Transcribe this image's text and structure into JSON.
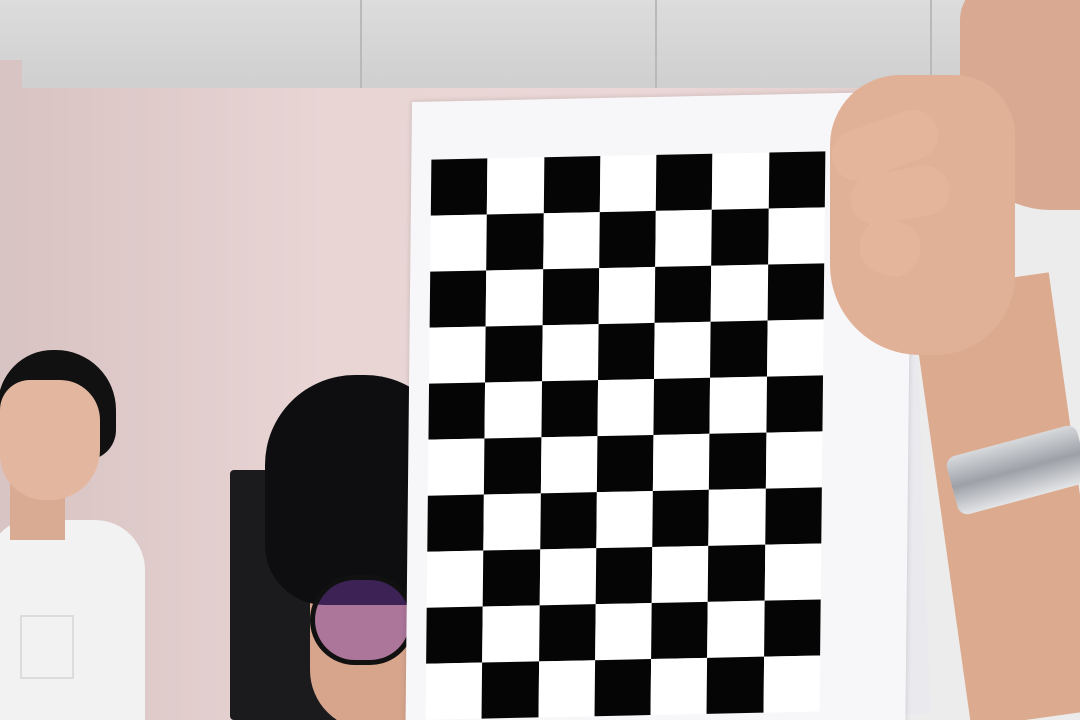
{
  "scene": {
    "description_tags": [
      "ceiling",
      "wall",
      "monitor",
      "person-left",
      "person-center",
      "person-right",
      "calibration-checkerboard"
    ]
  },
  "checkerboard": {
    "columns": 7,
    "rows": 10,
    "dark_color": "#050505",
    "light_color": "#ffffff",
    "first_square_dark": false
  },
  "colors": {
    "wall": "#e8d5d4",
    "ceiling": "#d6d6d6",
    "skin": "#e1b197",
    "hair": "#111111",
    "shirt": "#f2f2f2"
  }
}
